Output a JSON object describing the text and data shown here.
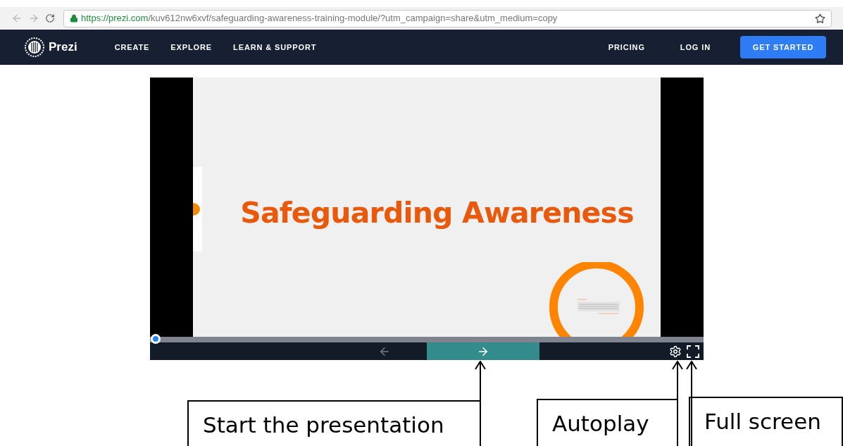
{
  "browser": {
    "url_host": "https://prezi.com",
    "url_path": "/kuv612nw6xvf/safeguarding-awareness-training-module/?utm_campaign=share&utm_medium=copy",
    "secure": true
  },
  "nav": {
    "logo": "Prezi",
    "links": [
      {
        "label": "CREATE"
      },
      {
        "label": "EXPLORE"
      },
      {
        "label": "LEARN & SUPPORT"
      }
    ],
    "right_links": [
      {
        "label": "PRICING"
      },
      {
        "label": "LOG IN"
      }
    ],
    "cta": "GET STARTED"
  },
  "player": {
    "slide_title": "Safeguarding Awareness",
    "progress": {
      "level": 0
    }
  },
  "callouts": [
    {
      "text": "Start the presentation",
      "kind": "next"
    },
    {
      "text": "Autoplay",
      "kind": "autoplay"
    },
    {
      "text": "Full screen",
      "kind": "fullscreen"
    }
  ]
}
